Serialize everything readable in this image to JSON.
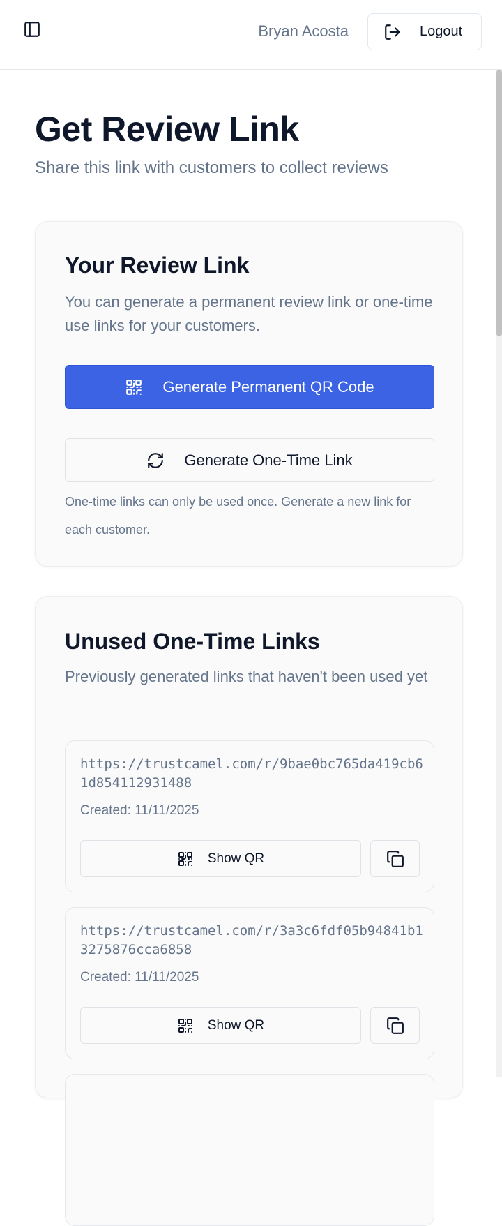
{
  "header": {
    "user_name": "Bryan Acosta",
    "logout_label": "Logout",
    "sidebar_toggle_icon": "panel-left-icon",
    "logout_icon": "log-out-icon"
  },
  "page": {
    "title": "Get Review Link",
    "subtitle": "Share this link with customers to collect reviews"
  },
  "review_link_card": {
    "title": "Your Review Link",
    "description": "You can generate a permanent review link or one-time use links for your customers.",
    "permanent_button_label": "Generate Permanent QR Code",
    "permanent_button_icon": "qr-code-icon",
    "one_time_button_label": "Generate One-Time Link",
    "one_time_button_icon": "refresh-icon",
    "help_text": "One-time links can only be used once. Generate a new link for each customer."
  },
  "unused_links_card": {
    "title": "Unused One-Time Links",
    "description": "Previously generated links that haven't been used yet",
    "items": [
      {
        "url": "https://trustcamel.com/r/9bae0bc765da419cb61d854112931488",
        "created": "Created: 11/11/2025",
        "show_qr_label": "Show QR"
      },
      {
        "url": "https://trustcamel.com/r/3a3c6fdf05b94841b13275876cca6858",
        "created": "Created: 11/11/2025",
        "show_qr_label": "Show QR"
      }
    ]
  },
  "colors": {
    "primary": "#3b63e3",
    "muted_text": "#64748b",
    "heading_text": "#0f172a",
    "card_background": "#fafafa"
  }
}
